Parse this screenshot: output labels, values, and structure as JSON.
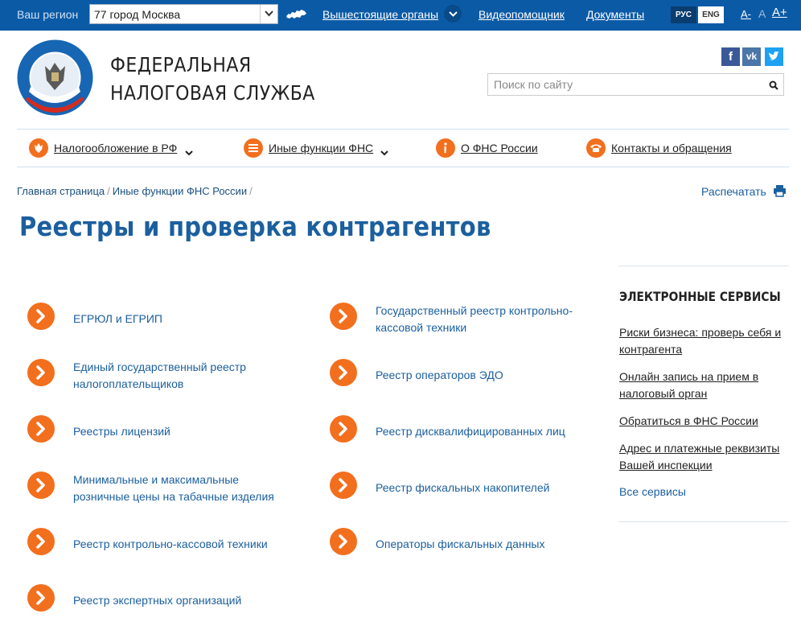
{
  "topbar": {
    "region_label": "Ваш регион",
    "region_value": "77 город Москва",
    "links": [
      "Вышестоящие органы",
      "Видеопомощник",
      "Документы"
    ],
    "lang_ru": "РУС",
    "lang_en": "ENG",
    "font_small": "A-",
    "font_normal": "A",
    "font_large": "A+"
  },
  "header": {
    "title_line1": "ФЕДЕРАЛЬНАЯ",
    "title_line2": "НАЛОГОВАЯ СЛУЖБА",
    "search_placeholder": "Поиск по сайту"
  },
  "nav": {
    "items": [
      {
        "label": "Налогообложение в РФ",
        "icon": "emblem-icon"
      },
      {
        "label": "Иные функции ФНС",
        "icon": "menu-icon"
      },
      {
        "label": "О ФНС России",
        "icon": "info-icon"
      },
      {
        "label": "Контакты и обращения",
        "icon": "phone-icon"
      }
    ]
  },
  "breadcrumb": {
    "items": [
      "Главная страница",
      "Иные функции ФНС России"
    ],
    "separator": "/"
  },
  "print_label": "Распечатать",
  "page_title": "Реестры и проверка контрагентов",
  "registries": {
    "left": [
      "ЕГРЮЛ и ЕГРИП",
      "Единый государственный реестр налогоплательщиков",
      "Реестры лицензий",
      "Минимальные и максимальные розничные цены на табачные изделия",
      "Реестр контрольно-кассовой техники",
      "Реестр экспертных организаций"
    ],
    "right": [
      "Государственный реестр контрольно-кассовой техники",
      "Реестр операторов ЭДО",
      "Реестр дисквалифицированных лиц",
      "Реестр фискальных накопителей",
      "Операторы фискальных данных"
    ]
  },
  "sidebar": {
    "title": "ЭЛЕКТРОННЫЕ СЕРВИСЫ",
    "links": [
      "Риски бизнеса: проверь себя и контрагента",
      "Онлайн запись на прием в налоговый орган",
      "Обратиться в ФНС России",
      "Адрес и платежные реквизиты Вашей инспекции"
    ],
    "all_label": "Все сервисы"
  },
  "colors": {
    "topbar": "#0b5aa6",
    "accent": "#f26f1e",
    "link": "#1b5f9e"
  }
}
